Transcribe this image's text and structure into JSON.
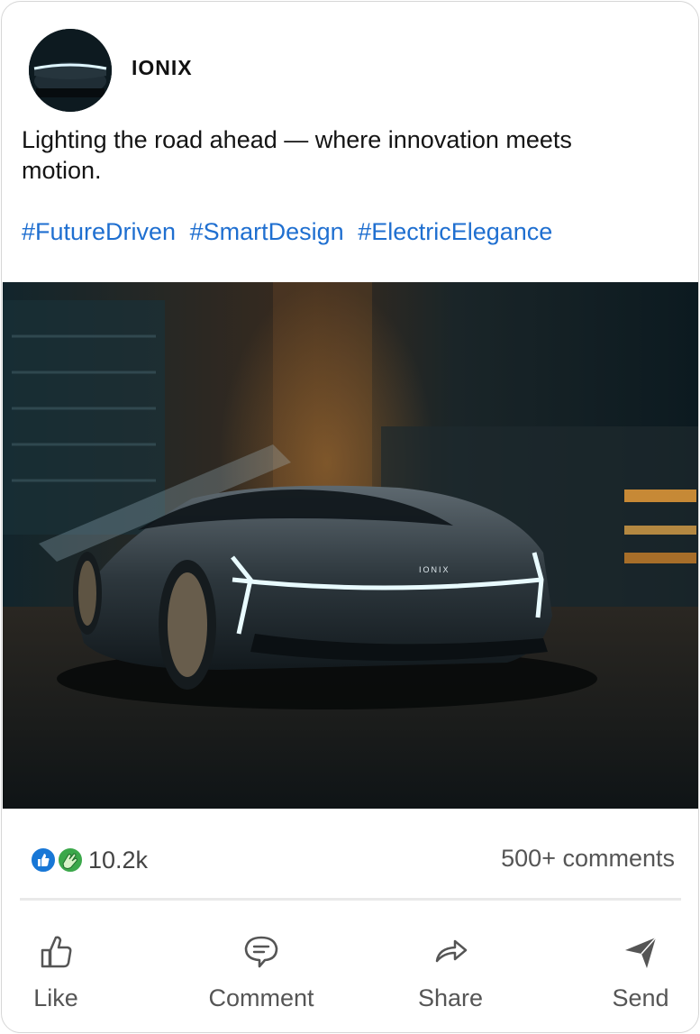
{
  "post": {
    "author": "IONIX",
    "caption": "Lighting the road ahead — where innovation meets motion.",
    "hashtags": [
      "#FutureDriven",
      "#SmartDesign",
      "#ElectricElegance"
    ],
    "media_text": "IONIX"
  },
  "stats": {
    "reaction_icons": [
      "like-icon",
      "clap-icon"
    ],
    "reaction_count": "10.2k",
    "comments_count": "500+ comments"
  },
  "actions": {
    "like": "Like",
    "comment": "Comment",
    "share": "Share",
    "send": "Send"
  },
  "colors": {
    "hashtag": "#1f6fd0",
    "like_badge": "#1877d6",
    "clap_badge": "#3ba84a"
  }
}
